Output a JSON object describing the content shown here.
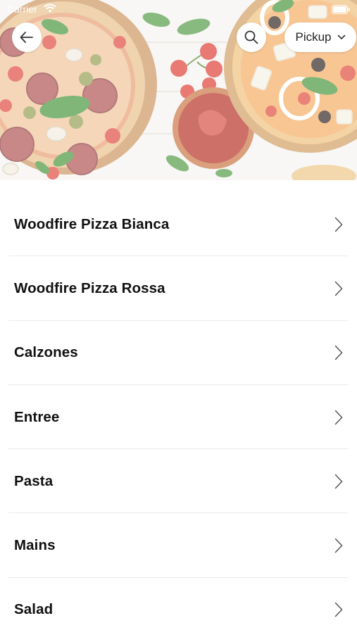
{
  "status_bar": {
    "carrier": "Carrier",
    "wifi_icon": "wifi-icon",
    "battery_icon": "battery-icon"
  },
  "header": {
    "back_icon": "arrow-left-icon",
    "search_icon": "search-icon",
    "pickup_label": "Pickup",
    "pickup_icon": "chevron-down-icon"
  },
  "categories": [
    {
      "label": "Woodfire Pizza Bianca"
    },
    {
      "label": "Woodfire Pizza Rossa"
    },
    {
      "label": "Calzones"
    },
    {
      "label": "Entree"
    },
    {
      "label": "Pasta"
    },
    {
      "label": "Mains"
    },
    {
      "label": "Salad"
    }
  ],
  "colors": {
    "background": "#ffffff",
    "text": "#111111",
    "divider": "#ececec",
    "chevron": "#555555"
  }
}
